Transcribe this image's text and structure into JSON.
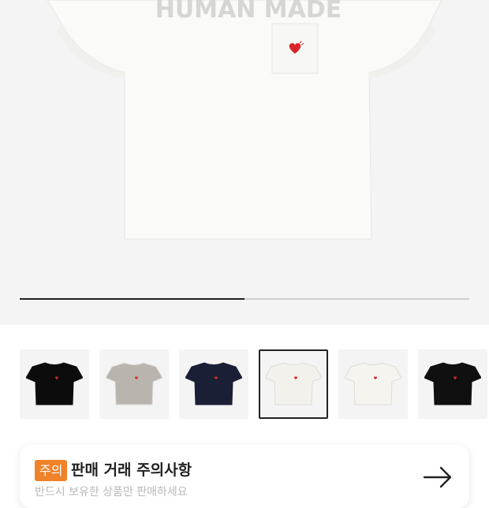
{
  "hero": {
    "image_alt": "HUMAN MADE white pocket t-shirt",
    "shirt_print": "HUMAN MADE",
    "heart_text": "HUMAN MADE",
    "carousel_progress": 0.5
  },
  "thumbnails": [
    {
      "color": "#0c0c0c",
      "selected": false
    },
    {
      "color": "#b9b4ad",
      "selected": false
    },
    {
      "color": "#1b1f36",
      "selected": false
    },
    {
      "color": "#f3f1ec",
      "selected": true
    },
    {
      "color": "#f6f4ef",
      "selected": false
    },
    {
      "color": "#101010",
      "selected": false
    }
  ],
  "notice": {
    "badge": "주의",
    "title": "판매 거래 주의사항",
    "subtitle": "반드시 보유한 상품만 판매하세요",
    "arrow_icon": "arrow-right-icon"
  },
  "colors": {
    "accent": "#f0822a",
    "heart": "#d8262b"
  }
}
